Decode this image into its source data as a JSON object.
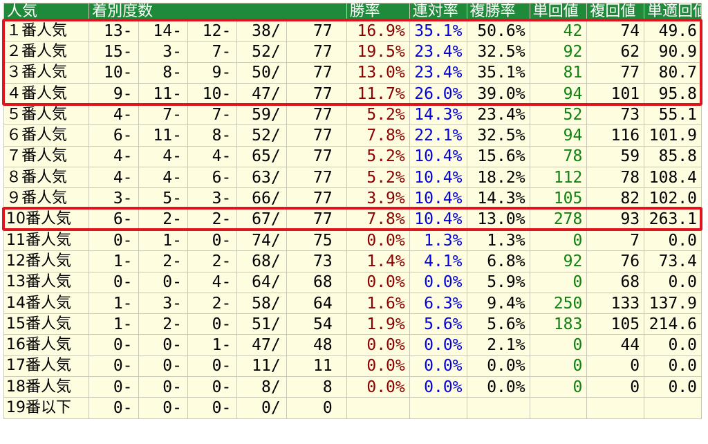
{
  "chart_data": {
    "type": "table",
    "headers": [
      "人気",
      "着別度数",
      "勝率",
      "連対率",
      "複勝率",
      "単回値",
      "複回値",
      "単適回値"
    ],
    "rows": [
      {
        "pop": "１番人気",
        "f1": "13-",
        "f2": "14-",
        "f3": "12-",
        "f4": "38/",
        "total": "77",
        "win": "16.9%",
        "quinella": "35.1%",
        "show": "50.6%",
        "win_ret": "42",
        "show_ret": "74",
        "adj_ret": "49.6"
      },
      {
        "pop": "２番人気",
        "f1": "15-",
        "f2": "3-",
        "f3": "7-",
        "f4": "52/",
        "total": "77",
        "win": "19.5%",
        "quinella": "23.4%",
        "show": "32.5%",
        "win_ret": "92",
        "show_ret": "62",
        "adj_ret": "90.9"
      },
      {
        "pop": "３番人気",
        "f1": "10-",
        "f2": "8-",
        "f3": "9-",
        "f4": "50/",
        "total": "77",
        "win": "13.0%",
        "quinella": "23.4%",
        "show": "35.1%",
        "win_ret": "81",
        "show_ret": "77",
        "adj_ret": "80.7"
      },
      {
        "pop": "４番人気",
        "f1": "9-",
        "f2": "11-",
        "f3": "10-",
        "f4": "47/",
        "total": "77",
        "win": "11.7%",
        "quinella": "26.0%",
        "show": "39.0%",
        "win_ret": "94",
        "show_ret": "101",
        "adj_ret": "95.8"
      },
      {
        "pop": "５番人気",
        "f1": "4-",
        "f2": "7-",
        "f3": "7-",
        "f4": "59/",
        "total": "77",
        "win": "5.2%",
        "quinella": "14.3%",
        "show": "23.4%",
        "win_ret": "52",
        "show_ret": "73",
        "adj_ret": "55.1"
      },
      {
        "pop": "６番人気",
        "f1": "6-",
        "f2": "11-",
        "f3": "8-",
        "f4": "52/",
        "total": "77",
        "win": "7.8%",
        "quinella": "22.1%",
        "show": "32.5%",
        "win_ret": "94",
        "show_ret": "116",
        "adj_ret": "101.9"
      },
      {
        "pop": "７番人気",
        "f1": "4-",
        "f2": "4-",
        "f3": "4-",
        "f4": "65/",
        "total": "77",
        "win": "5.2%",
        "quinella": "10.4%",
        "show": "15.6%",
        "win_ret": "78",
        "show_ret": "59",
        "adj_ret": "85.8"
      },
      {
        "pop": "８番人気",
        "f1": "4-",
        "f2": "4-",
        "f3": "6-",
        "f4": "63/",
        "total": "77",
        "win": "5.2%",
        "quinella": "10.4%",
        "show": "18.2%",
        "win_ret": "112",
        "show_ret": "78",
        "adj_ret": "108.4"
      },
      {
        "pop": "９番人気",
        "f1": "3-",
        "f2": "5-",
        "f3": "3-",
        "f4": "66/",
        "total": "77",
        "win": "3.9%",
        "quinella": "10.4%",
        "show": "14.3%",
        "win_ret": "105",
        "show_ret": "82",
        "adj_ret": "102.0"
      },
      {
        "pop": "10番人気",
        "f1": "6-",
        "f2": "2-",
        "f3": "2-",
        "f4": "67/",
        "total": "77",
        "win": "7.8%",
        "quinella": "10.4%",
        "show": "13.0%",
        "win_ret": "278",
        "show_ret": "93",
        "adj_ret": "263.1"
      },
      {
        "pop": "11番人気",
        "f1": "0-",
        "f2": "1-",
        "f3": "0-",
        "f4": "74/",
        "total": "75",
        "win": "0.0%",
        "quinella": "1.3%",
        "show": "1.3%",
        "win_ret": "0",
        "show_ret": "7",
        "adj_ret": "0.0"
      },
      {
        "pop": "12番人気",
        "f1": "1-",
        "f2": "2-",
        "f3": "2-",
        "f4": "68/",
        "total": "73",
        "win": "1.4%",
        "quinella": "4.1%",
        "show": "6.8%",
        "win_ret": "92",
        "show_ret": "76",
        "adj_ret": "73.4"
      },
      {
        "pop": "13番人気",
        "f1": "0-",
        "f2": "0-",
        "f3": "4-",
        "f4": "64/",
        "total": "68",
        "win": "0.0%",
        "quinella": "0.0%",
        "show": "5.9%",
        "win_ret": "0",
        "show_ret": "68",
        "adj_ret": "0.0"
      },
      {
        "pop": "14番人気",
        "f1": "1-",
        "f2": "3-",
        "f3": "2-",
        "f4": "58/",
        "total": "64",
        "win": "1.6%",
        "quinella": "6.3%",
        "show": "9.4%",
        "win_ret": "250",
        "show_ret": "133",
        "adj_ret": "137.9"
      },
      {
        "pop": "15番人気",
        "f1": "1-",
        "f2": "2-",
        "f3": "0-",
        "f4": "51/",
        "total": "54",
        "win": "1.9%",
        "quinella": "5.6%",
        "show": "5.6%",
        "win_ret": "183",
        "show_ret": "105",
        "adj_ret": "214.6"
      },
      {
        "pop": "16番人気",
        "f1": "0-",
        "f2": "0-",
        "f3": "1-",
        "f4": "47/",
        "total": "48",
        "win": "0.0%",
        "quinella": "0.0%",
        "show": "2.1%",
        "win_ret": "0",
        "show_ret": "44",
        "adj_ret": "0.0"
      },
      {
        "pop": "17番人気",
        "f1": "0-",
        "f2": "0-",
        "f3": "0-",
        "f4": "11/",
        "total": "11",
        "win": "0.0%",
        "quinella": "0.0%",
        "show": "0.0%",
        "win_ret": "0",
        "show_ret": "0",
        "adj_ret": "0.0"
      },
      {
        "pop": "18番人気",
        "f1": "0-",
        "f2": "0-",
        "f3": "0-",
        "f4": "8/",
        "total": "8",
        "win": "0.0%",
        "quinella": "0.0%",
        "show": "0.0%",
        "win_ret": "0",
        "show_ret": "0",
        "adj_ret": "0.0"
      },
      {
        "pop": "19番以下",
        "f1": "0-",
        "f2": "0-",
        "f3": "0-",
        "f4": "0/",
        "total": "0",
        "win": "",
        "quinella": "",
        "show": "",
        "win_ret": "",
        "show_ret": "",
        "adj_ret": ""
      }
    ],
    "highlighted_rows": [
      0,
      1,
      2,
      3,
      9
    ],
    "colors": {
      "header_bg": "#1f8a3a",
      "header_text": "#ffffff",
      "cell_bg": "#fffde0",
      "win_rate": "#8b0000",
      "quinella_rate": "#0000e0",
      "win_return": "#108010",
      "highlight": "#e0141e"
    }
  }
}
